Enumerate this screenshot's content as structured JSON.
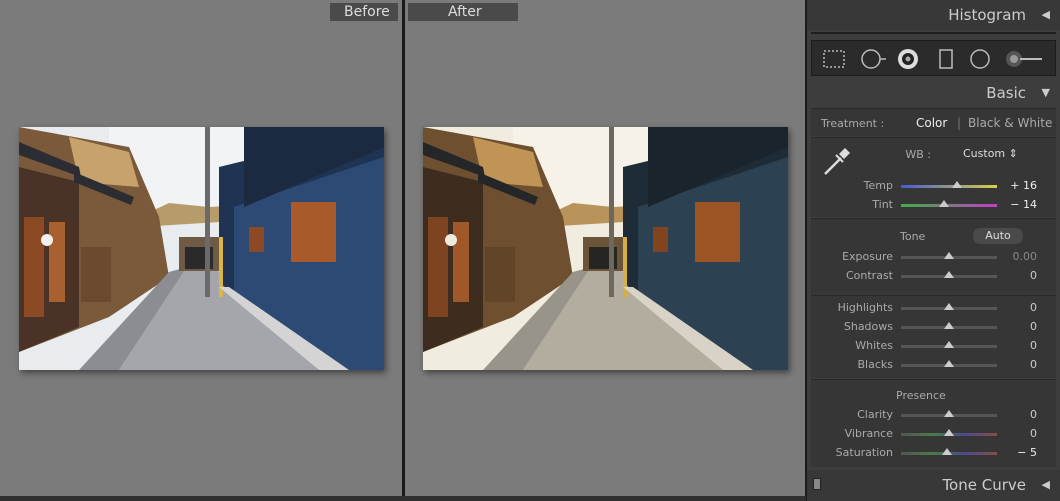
{
  "compare": {
    "before_label": "Before",
    "after_label": "After"
  },
  "panel": {
    "histogram": {
      "title": "Histogram",
      "arrow": "◀"
    },
    "tools": [
      "crop-overlay-icon",
      "spot-removal-icon",
      "red-eye-icon",
      "graduated-filter-icon",
      "radial-filter-icon",
      "adjustment-brush-icon"
    ],
    "basic": {
      "title": "Basic",
      "arrow": "▼",
      "treatment_label": "Treatment :",
      "treatment_color": "Color",
      "treatment_divider": "|",
      "treatment_bw": "Black & White",
      "wb_label": "WB :",
      "wb_value": "Custom ⇕",
      "temp": {
        "label": "Temp",
        "value": "+ 16",
        "position": 0.58
      },
      "tint": {
        "label": "Tint",
        "value": "− 14",
        "position": 0.45
      },
      "tone_label": "Tone",
      "auto_label": "Auto",
      "exposure": {
        "label": "Exposure",
        "value": "0.00",
        "position": 0.5
      },
      "contrast": {
        "label": "Contrast",
        "value": "0",
        "position": 0.5
      },
      "highlights": {
        "label": "Highlights",
        "value": "0",
        "position": 0.5
      },
      "shadows": {
        "label": "Shadows",
        "value": "0",
        "position": 0.5
      },
      "whites": {
        "label": "Whites",
        "value": "0",
        "position": 0.5
      },
      "blacks": {
        "label": "Blacks",
        "value": "0",
        "position": 0.5
      },
      "presence_label": "Presence",
      "clarity": {
        "label": "Clarity",
        "value": "0",
        "position": 0.5
      },
      "vibrance": {
        "label": "Vibrance",
        "value": "0",
        "position": 0.5
      },
      "saturation": {
        "label": "Saturation",
        "value": "− 5",
        "position": 0.475
      }
    },
    "tone_curve": {
      "title": "Tone Curve",
      "arrow": "◀"
    }
  },
  "colors": {
    "panel_bg": "#3d3d3d",
    "canvas_bg": "#7b7b7b",
    "temp_gradient_start": "#4a5bd0",
    "temp_gradient_end": "#d8cf4a",
    "tint_gradient_start": "#3fae45",
    "tint_gradient_end": "#c03fc4"
  }
}
